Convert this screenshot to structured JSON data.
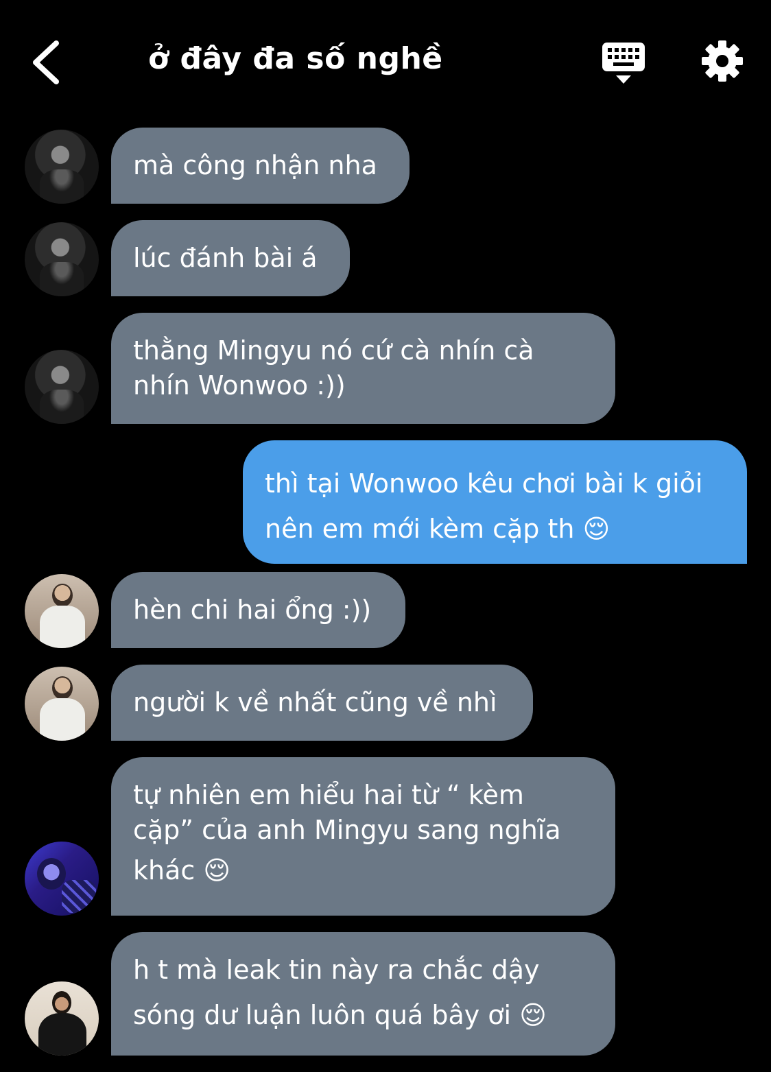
{
  "header": {
    "title": "ở đây đa số nghề"
  },
  "colors": {
    "background": "#000000",
    "received_bubble": "#6b7886",
    "sent_bubble": "#4b9ee9"
  },
  "icons": {
    "back": "chevron-left-icon",
    "keyboard": "keyboard-icon",
    "settings": "gear-icon"
  },
  "messages": [
    {
      "sender": "other",
      "lines": [
        "mà công nhận nha"
      ]
    },
    {
      "sender": "other",
      "lines": [
        "lúc đánh bài á"
      ]
    },
    {
      "sender": "other",
      "lines": [
        "thằng Mingyu nó cứ cà nhín cà",
        "nhín Wonwoo :))"
      ]
    },
    {
      "sender": "me",
      "lines": [
        "thì tại Wonwoo kêu chơi bài k giỏi",
        "nên em mới kèm cặp th 😌"
      ]
    },
    {
      "sender": "other",
      "lines": [
        "hèn chi hai ổng :))"
      ]
    },
    {
      "sender": "other",
      "lines": [
        "người k về nhất cũng về nhì"
      ]
    },
    {
      "sender": "other",
      "lines": [
        "tự nhiên em hiểu hai từ “ kèm",
        "cặp” của anh Mingyu sang nghĩa",
        "khác 😌"
      ]
    },
    {
      "sender": "other",
      "lines": [
        "h t mà leak tin này ra chắc dậy",
        "sóng dư luận luôn quá bây ơi 😌"
      ]
    }
  ]
}
